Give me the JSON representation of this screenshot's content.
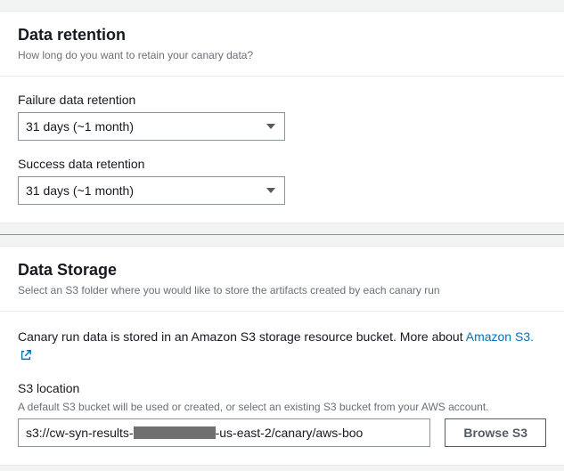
{
  "retention": {
    "title": "Data retention",
    "desc": "How long do you want to retain your canary data?",
    "failure_label": "Failure data retention",
    "failure_value": "31 days (~1 month)",
    "success_label": "Success data retention",
    "success_value": "31 days (~1 month)"
  },
  "storage": {
    "title": "Data Storage",
    "desc": "Select an S3 folder where you would like to store the artifacts created by each canary run",
    "intro_prefix": "Canary run data is stored in an Amazon S3 storage resource bucket. More about ",
    "intro_link": "Amazon S3.",
    "location_label": "S3 location",
    "location_hint": "A default S3 bucket will be used or created, or select an existing S3 bucket from your AWS account.",
    "location_prefix": "s3://cw-syn-results-",
    "location_suffix": "-us-east-2/canary/aws-boo",
    "browse_label": "Browse S3"
  }
}
